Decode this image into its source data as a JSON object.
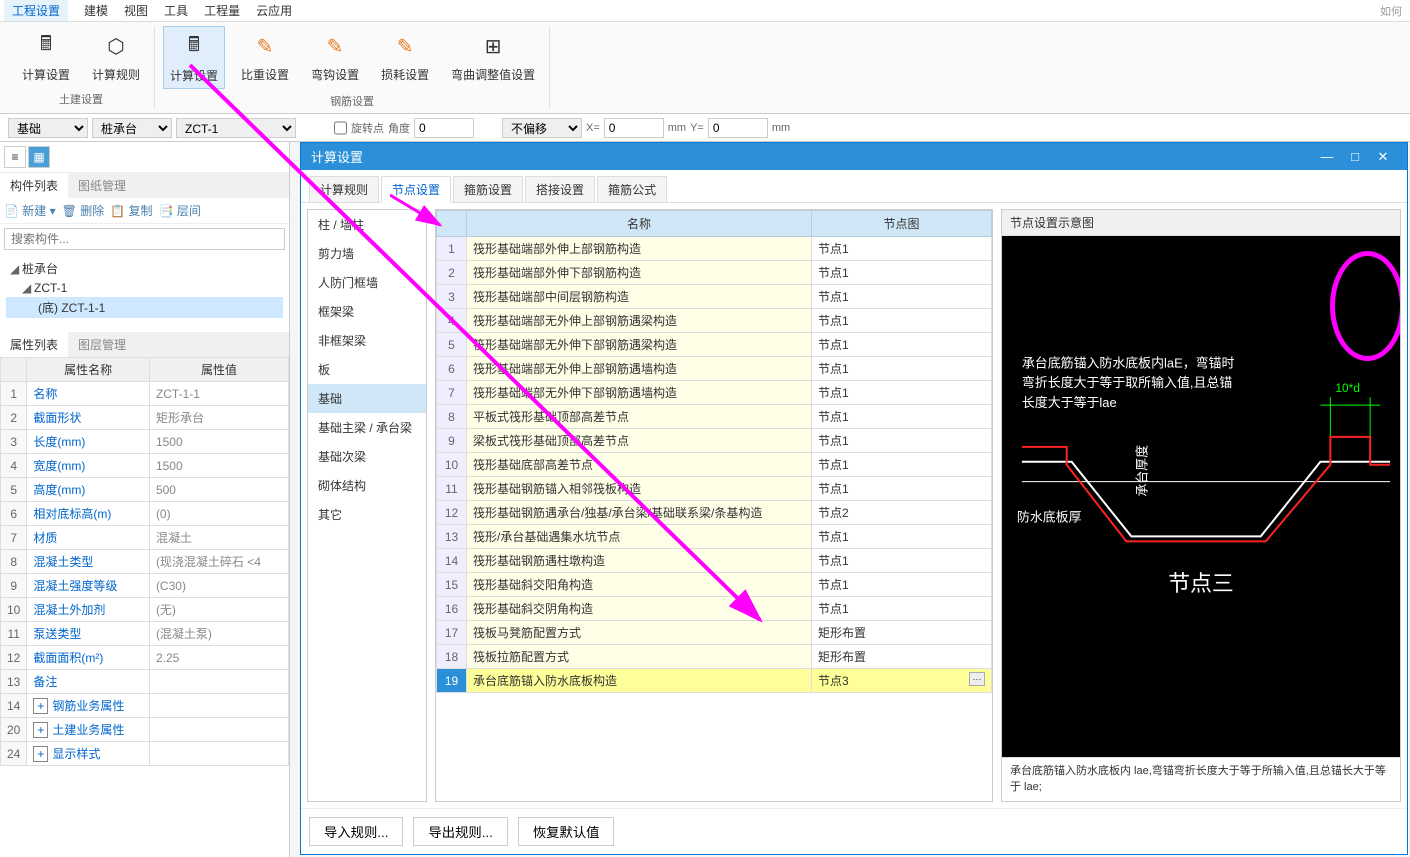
{
  "menu": {
    "items": [
      "工程设置",
      "建模",
      "视图",
      "工具",
      "工程量",
      "云应用"
    ],
    "active_index": 0,
    "help_hint": "如何"
  },
  "ribbon": {
    "groups": [
      {
        "label": "土建设置",
        "items": [
          {
            "label": "计算设置",
            "icon": "calculator-icon"
          },
          {
            "label": "计算规则",
            "icon": "rules-icon"
          }
        ]
      },
      {
        "label": "钢筋设置",
        "items": [
          {
            "label": "计算设置",
            "icon": "calc-selected-icon",
            "selected": true
          },
          {
            "label": "比重设置",
            "icon": "weight-icon"
          },
          {
            "label": "弯钩设置",
            "icon": "hook-icon"
          },
          {
            "label": "损耗设置",
            "icon": "loss-icon"
          },
          {
            "label": "弯曲调整值设置",
            "icon": "bend-icon"
          }
        ]
      }
    ]
  },
  "param_bar": {
    "select1": "基础",
    "select2": "桩承台",
    "select3": "ZCT-1",
    "rot_lbl": "旋转点",
    "angle_lbl": "角度",
    "angle_val": "0",
    "offset_sel": "不偏移",
    "x_lbl": "X=",
    "x_val": "0",
    "mm1": "mm",
    "y_lbl": "Y=",
    "y_val": "0",
    "mm2": "mm"
  },
  "left_panel": {
    "tabs": [
      "构件列表",
      "图纸管理"
    ],
    "active": 0,
    "toolbar": {
      "new": "新建",
      "del": "删除",
      "copy": "复制",
      "inter": "层间"
    },
    "search_ph": "搜索构件...",
    "tree": [
      {
        "label": "桩承台",
        "level": 0,
        "exp": true
      },
      {
        "label": "ZCT-1",
        "level": 1,
        "exp": true
      },
      {
        "label": "(底) ZCT-1-1",
        "level": 2,
        "selected": true
      }
    ],
    "prop_tabs": [
      "属性列表",
      "图层管理"
    ],
    "prop_active": 0,
    "prop_cols": [
      "属性名称",
      "属性值"
    ],
    "props": [
      {
        "i": "1",
        "name": "名称",
        "val": "ZCT-1-1"
      },
      {
        "i": "2",
        "name": "截面形状",
        "val": "矩形承台"
      },
      {
        "i": "3",
        "name": "长度(mm)",
        "val": "1500"
      },
      {
        "i": "4",
        "name": "宽度(mm)",
        "val": "1500"
      },
      {
        "i": "5",
        "name": "高度(mm)",
        "val": "500"
      },
      {
        "i": "6",
        "name": "相对底标高(m)",
        "val": "(0)"
      },
      {
        "i": "7",
        "name": "材质",
        "val": "混凝土"
      },
      {
        "i": "8",
        "name": "混凝土类型",
        "val": "(现浇混凝土碎石 <4"
      },
      {
        "i": "9",
        "name": "混凝土强度等级",
        "val": "(C30)"
      },
      {
        "i": "10",
        "name": "混凝土外加剂",
        "val": "(无)"
      },
      {
        "i": "11",
        "name": "泵送类型",
        "val": "(混凝土泵)"
      },
      {
        "i": "12",
        "name": "截面面积(m²)",
        "val": "2.25"
      },
      {
        "i": "13",
        "name": "备注",
        "val": ""
      },
      {
        "i": "14",
        "name": "钢筋业务属性",
        "val": "",
        "exp": "+"
      },
      {
        "i": "20",
        "name": "土建业务属性",
        "val": "",
        "exp": "+"
      },
      {
        "i": "24",
        "name": "显示样式",
        "val": "",
        "exp": "+"
      }
    ]
  },
  "dialog": {
    "title": "计算设置",
    "tabs": [
      "计算规则",
      "节点设置",
      "箍筋设置",
      "搭接设置",
      "箍筋公式"
    ],
    "active_tab": 1,
    "cats": [
      "柱 / 墙柱",
      "剪力墙",
      "人防门框墙",
      "框架梁",
      "非框架梁",
      "板",
      "基础",
      "基础主梁 / 承台梁",
      "基础次梁",
      "砌体结构",
      "其它"
    ],
    "active_cat": 6,
    "grid_cols": [
      "",
      "名称",
      "节点图"
    ],
    "rows": [
      {
        "i": 1,
        "name": "筏形基础端部外伸上部钢筋构造",
        "node": "节点1"
      },
      {
        "i": 2,
        "name": "筏形基础端部外伸下部钢筋构造",
        "node": "节点1"
      },
      {
        "i": 3,
        "name": "筏形基础端部中间层钢筋构造",
        "node": "节点1"
      },
      {
        "i": 4,
        "name": "筏形基础端部无外伸上部钢筋遇梁构造",
        "node": "节点1"
      },
      {
        "i": 5,
        "name": "筏形基础端部无外伸下部钢筋遇梁构造",
        "node": "节点1"
      },
      {
        "i": 6,
        "name": "筏形基础端部无外伸上部钢筋遇墙构造",
        "node": "节点1"
      },
      {
        "i": 7,
        "name": "筏形基础端部无外伸下部钢筋遇墙构造",
        "node": "节点1"
      },
      {
        "i": 8,
        "name": "平板式筏形基础顶部高差节点",
        "node": "节点1"
      },
      {
        "i": 9,
        "name": "梁板式筏形基础顶部高差节点",
        "node": "节点1"
      },
      {
        "i": 10,
        "name": "筏形基础底部高差节点",
        "node": "节点1"
      },
      {
        "i": 11,
        "name": "筏形基础钢筋锚入相邻筏板构造",
        "node": "节点1"
      },
      {
        "i": 12,
        "name": "筏形基础钢筋遇承台/独基/承台梁/基础联系梁/条基构造",
        "node": "节点2"
      },
      {
        "i": 13,
        "name": "筏形/承台基础遇集水坑节点",
        "node": "节点1"
      },
      {
        "i": 14,
        "name": "筏形基础钢筋遇柱墩构造",
        "node": "节点1"
      },
      {
        "i": 15,
        "name": "筏形基础斜交阳角构造",
        "node": "节点1"
      },
      {
        "i": 16,
        "name": "筏形基础斜交阴角构造",
        "node": "节点1"
      },
      {
        "i": 17,
        "name": "筏板马凳筋配置方式",
        "node": "矩形布置"
      },
      {
        "i": 18,
        "name": "筏板拉筋配置方式",
        "node": "矩形布置"
      },
      {
        "i": 19,
        "name": "承台底筋锚入防水底板构造",
        "node": "节点3",
        "sel": true
      }
    ],
    "preview_title": "节点设置示意图",
    "diag": {
      "line1": "承台底筋锚入防水底板内laE，弯锚时",
      "line2": "弯折长度大于等于取所输入值,且总锚",
      "line3": "长度大于等于lae",
      "dim": "10*d",
      "label1": "防水底板厚",
      "label2": "承台厚度",
      "node_label": "节点三"
    },
    "preview_desc": "承台底筋锚入防水底板内 lae,弯锚弯折长度大于等于所输入值,且总锚长大于等于 lae;",
    "footer": {
      "import": "导入规则...",
      "export": "导出规则...",
      "reset": "恢复默认值"
    }
  }
}
